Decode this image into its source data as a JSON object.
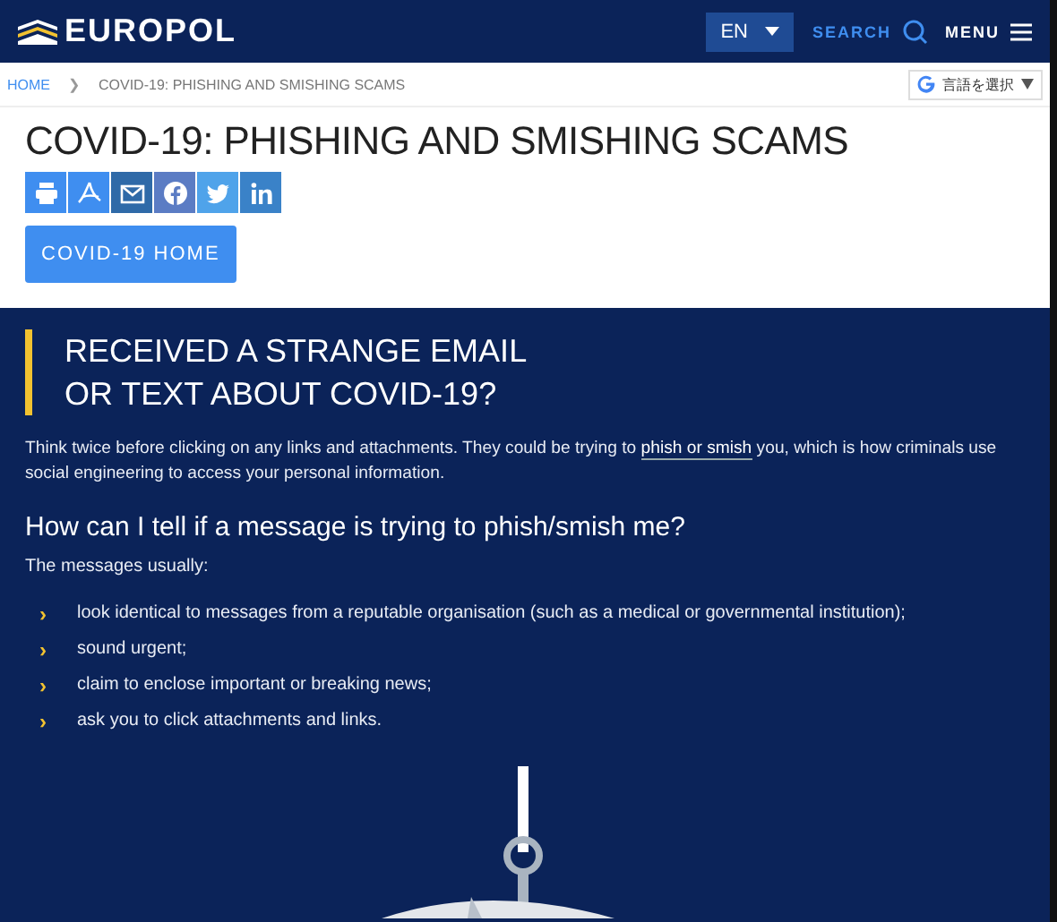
{
  "header": {
    "logo": "EUROPOL",
    "language": "EN",
    "search": "SEARCH",
    "menu": "MENU"
  },
  "breadcrumb": [
    {
      "label": "HOME",
      "kind": "link"
    },
    {
      "label": "COVID-19: PHISHING AND SMISHING SCAMS",
      "kind": "current"
    }
  ],
  "breadcrumb_separator": "❯",
  "translate": {
    "label": "言語を選択"
  },
  "title": "COVID-19: PHISHING AND SMISHING SCAMS",
  "share_buttons": [
    {
      "kind": "print",
      "color": "#3f8ef0"
    },
    {
      "kind": "pdf",
      "color": "#3f8ef0"
    },
    {
      "kind": "email",
      "color": "#2f6aa8"
    },
    {
      "kind": "facebook",
      "color": "#5b7cc4"
    },
    {
      "kind": "twitter",
      "color": "#4fa3ea"
    },
    {
      "kind": "linkedin",
      "color": "#3a82c8"
    }
  ],
  "home_button": "COVID-19 HOME",
  "section": {
    "heading_lines": [
      "RECEIVED A STRANGE EMAIL",
      "OR TEXT ABOUT COVID-19?"
    ],
    "intro_before": "Think twice before clicking on any links and attachments. They could be trying to ",
    "intro_link": "phish or smish",
    "intro_after": " you, which is how criminals use social engineering to access your personal information.",
    "subheading": "How can I tell if a message is trying to phish/smish me?",
    "lead": "The messages usually:",
    "bullets": [
      "›",
      "›",
      "›",
      "›"
    ],
    "items": [
      "look identical to messages from a reputable organisation (such as a medical or governmental institution);",
      "sound urgent;",
      "claim to enclose important or breaking news;",
      "ask you to click attachments and links."
    ]
  }
}
